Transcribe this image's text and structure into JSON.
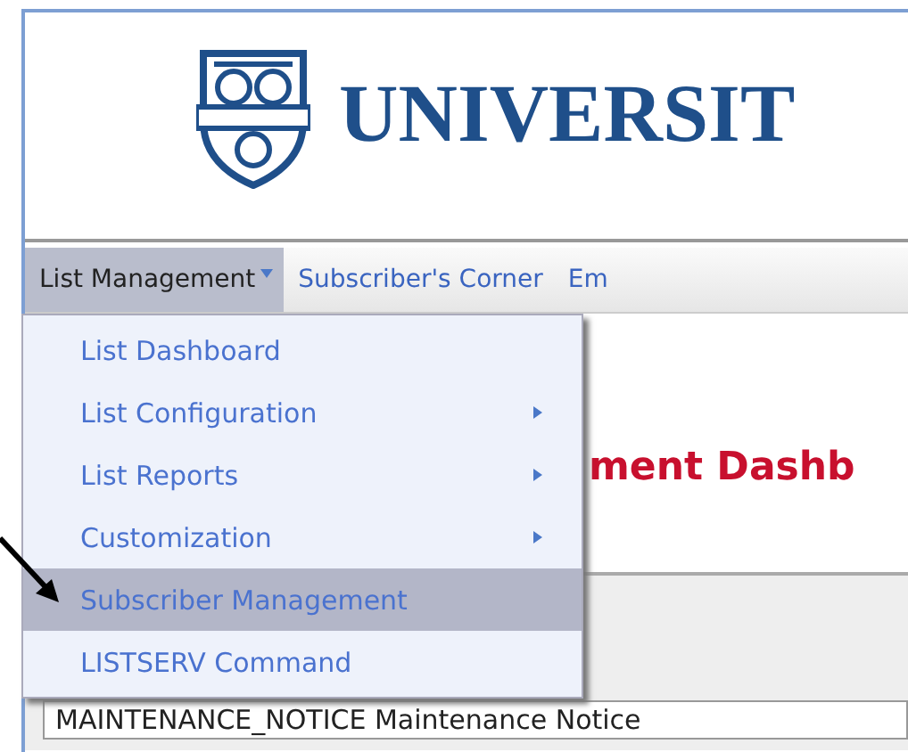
{
  "header": {
    "title": "UNIVERSIT"
  },
  "nav": [
    {
      "label": "List Management",
      "selected": true,
      "has_menu": true
    },
    {
      "label": "Subscriber's Corner",
      "selected": false,
      "has_menu": false
    },
    {
      "label": "Em",
      "selected": false,
      "has_menu": false
    }
  ],
  "menu": {
    "items": [
      {
        "label": "List Dashboard",
        "selected": false,
        "has_submenu": false
      },
      {
        "label": "List Configuration",
        "selected": false,
        "has_submenu": true
      },
      {
        "label": "List Reports",
        "selected": false,
        "has_submenu": true
      },
      {
        "label": "Customization",
        "selected": false,
        "has_submenu": true
      },
      {
        "label": "Subscriber Management",
        "selected": true,
        "has_submenu": false
      },
      {
        "label": "LISTSERV Command",
        "selected": false,
        "has_submenu": false
      }
    ]
  },
  "page": {
    "heading": "ment Dashb",
    "field_value": "MAINTENANCE_NOTICE Maintenance Notice"
  }
}
